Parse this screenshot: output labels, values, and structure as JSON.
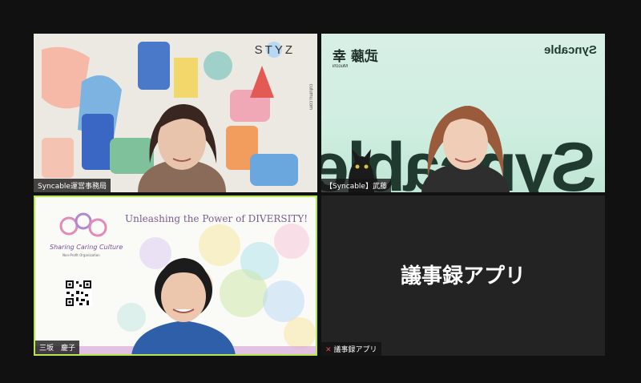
{
  "tiles": [
    {
      "name": "Syncable運営事務局"
    },
    {
      "name": "【Syncable】武藤"
    },
    {
      "name": "三坂　慶子"
    },
    {
      "name": "議事録アプリ"
    }
  ],
  "tile1": {
    "brand": "STYZ",
    "url": "culumu.com"
  },
  "tile2": {
    "logo_text": "Syncable",
    "jp_name": "武藤 幸",
    "jp_sub": "Mucchi",
    "big_text": "Syncable"
  },
  "tile3": {
    "banner": "Unleashing the Power of DIVERSITY!",
    "scc_title": "Sharing Caring Culture",
    "scc_sub": "Non-Profit Organization"
  },
  "tile4": {
    "display_name": "議事録アプリ"
  },
  "colors": {
    "active_speaker": "#b6e84a",
    "background": "#111111"
  }
}
